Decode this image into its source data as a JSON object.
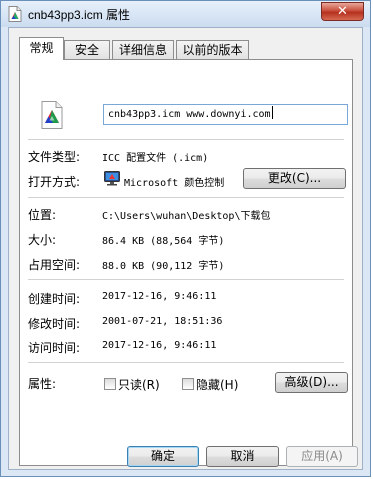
{
  "window": {
    "title": "cnb43pp3.icm 属性",
    "close_label": "✕"
  },
  "tabs": [
    {
      "label": "常规",
      "active": true
    },
    {
      "label": "安全",
      "active": false
    },
    {
      "label": "详细信息",
      "active": false
    },
    {
      "label": "以前的版本",
      "active": false
    }
  ],
  "general": {
    "filename": "cnb43pp3.icm www.downyi.com",
    "file_type_label": "文件类型:",
    "file_type_value": "ICC 配置文件 (.icm)",
    "open_with_label": "打开方式:",
    "open_with_value": "Microsoft 颜色控制",
    "change_button": "更改(C)...",
    "location_label": "位置:",
    "location_value": "C:\\Users\\wuhan\\Desktop\\下载包",
    "size_label": "大小:",
    "size_value": "86.4 KB (88,564 字节)",
    "size_on_disk_label": "占用空间:",
    "size_on_disk_value": "88.0 KB (90,112 字节)",
    "created_label": "创建时间:",
    "created_value": "2017-12-16, 9:46:11",
    "modified_label": "修改时间:",
    "modified_value": "2001-07-21, 18:51:36",
    "accessed_label": "访问时间:",
    "accessed_value": "2017-12-16, 9:46:11",
    "attributes_label": "属性:",
    "readonly_label": "只读(R)",
    "readonly_checked": false,
    "hidden_label": "隐藏(H)",
    "hidden_checked": false,
    "advanced_button": "高级(D)..."
  },
  "footer": {
    "ok": "确定",
    "cancel": "取消",
    "apply": "应用(A)"
  }
}
